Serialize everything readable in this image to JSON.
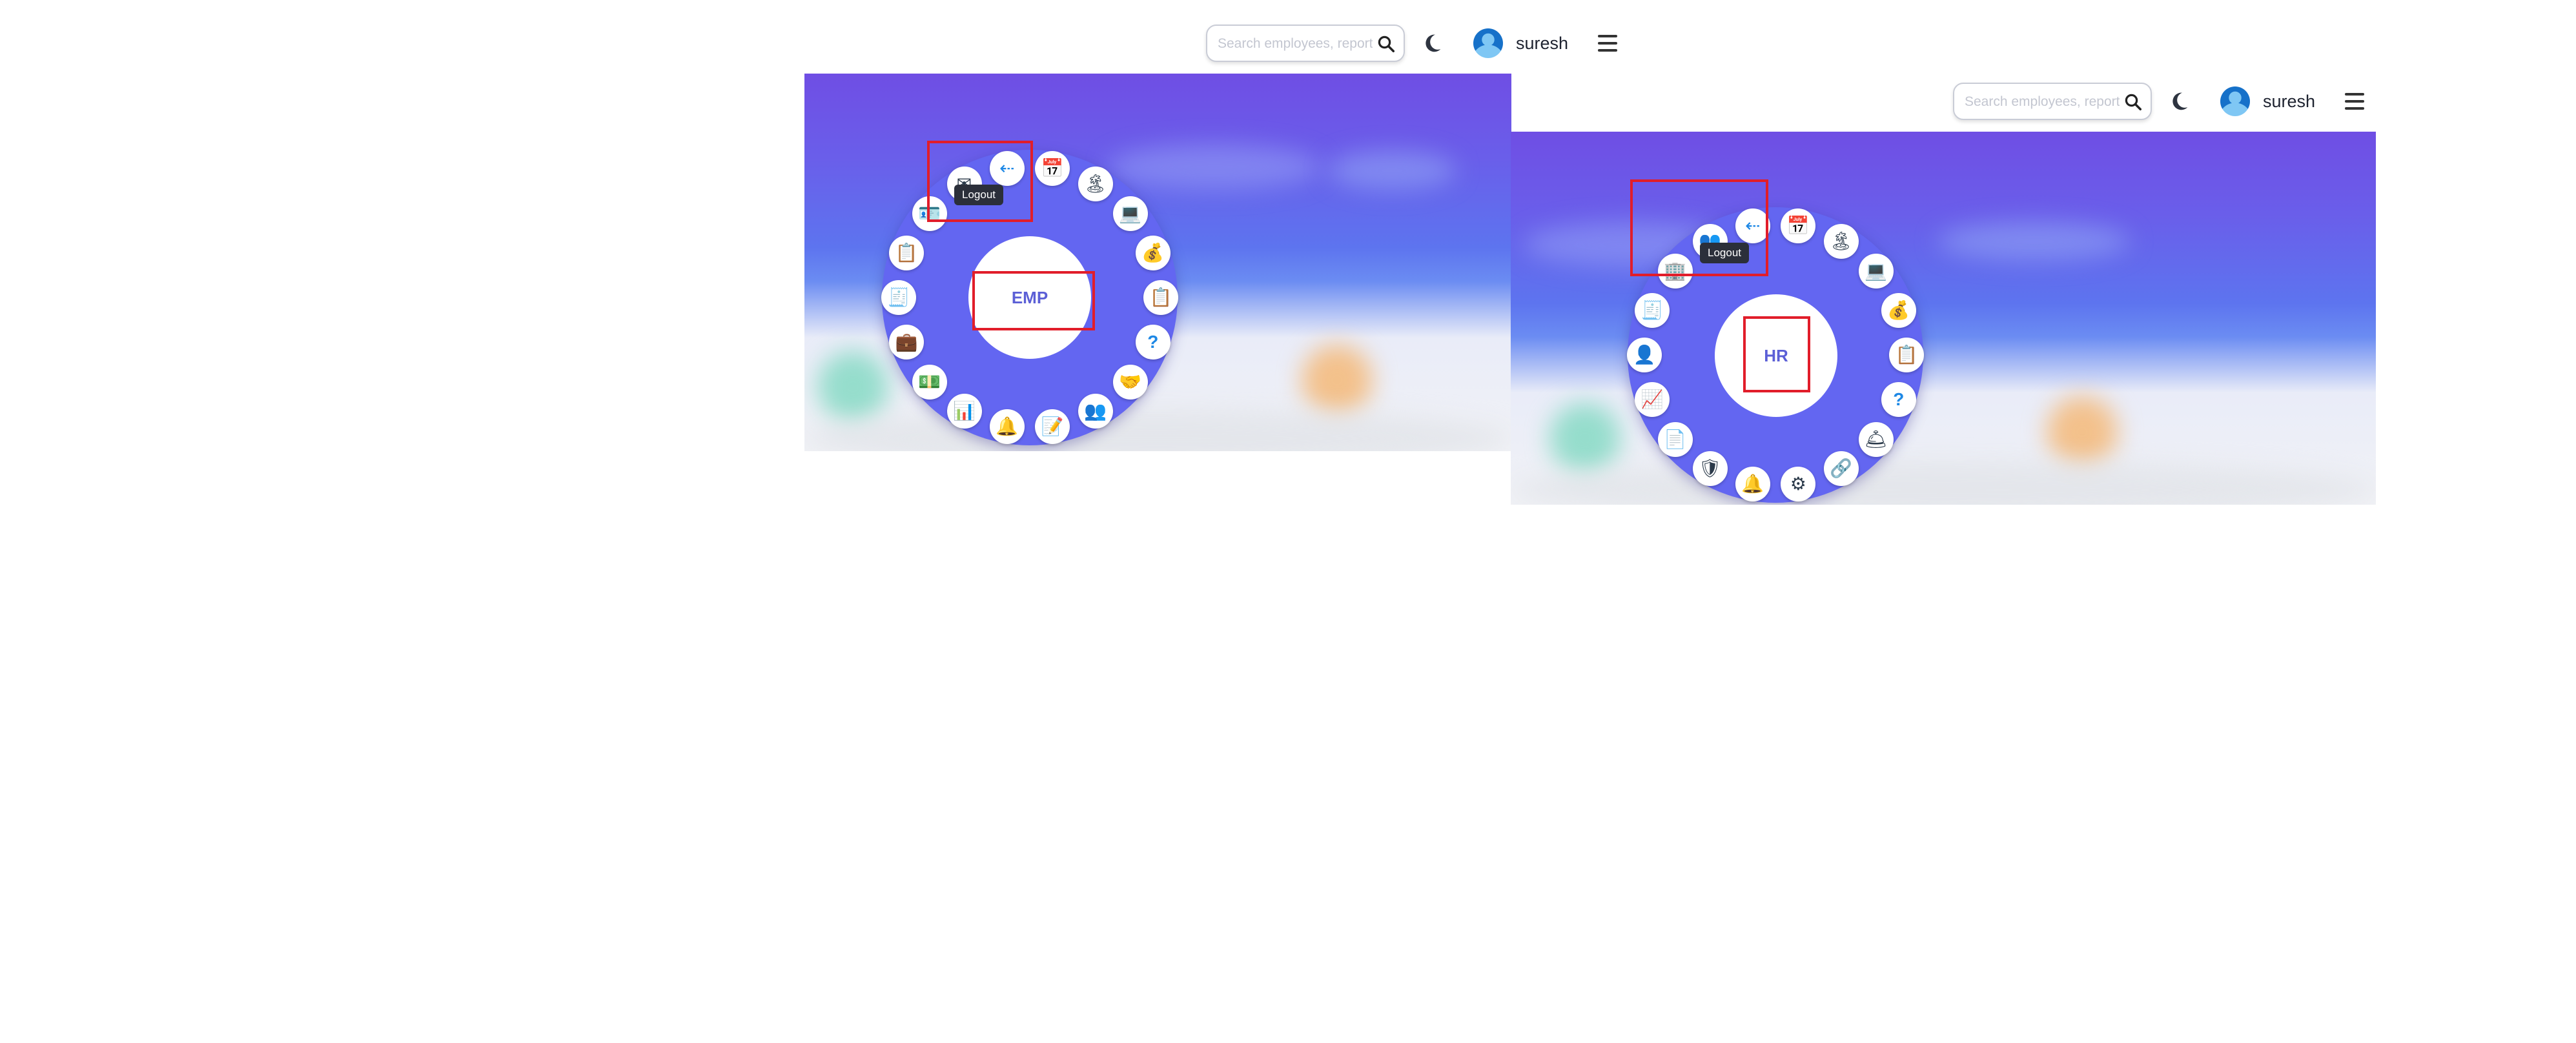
{
  "header": {
    "search_placeholder": "Search employees, reports...",
    "username": "suresh"
  },
  "icons": {
    "search": "search-icon",
    "theme": "moon-icon",
    "avatar": "user-avatar-icon",
    "menu": "hamburger-menu-icon"
  },
  "emp_panel": {
    "center_label": "EMP",
    "tooltip": "Logout",
    "items": [
      {
        "name": "logout",
        "glyph": "⇠"
      },
      {
        "name": "calendar",
        "glyph": "📅"
      },
      {
        "name": "holiday",
        "glyph": "🏝"
      },
      {
        "name": "laptop",
        "glyph": "💻"
      },
      {
        "name": "money-bag",
        "glyph": "💰"
      },
      {
        "name": "document",
        "glyph": "📋"
      },
      {
        "name": "help",
        "glyph": "?"
      },
      {
        "name": "handshake",
        "glyph": "🤝"
      },
      {
        "name": "team",
        "glyph": "👥"
      },
      {
        "name": "checklist",
        "glyph": "📝"
      },
      {
        "name": "bell",
        "glyph": "🔔"
      },
      {
        "name": "report",
        "glyph": "📊"
      },
      {
        "name": "payroll",
        "glyph": "💵"
      },
      {
        "name": "briefcase",
        "glyph": "💼"
      },
      {
        "name": "form",
        "glyph": "🧾"
      },
      {
        "name": "clipboard",
        "glyph": "📋"
      },
      {
        "name": "id-card",
        "glyph": "🪪"
      },
      {
        "name": "mail",
        "glyph": "✉"
      }
    ]
  },
  "hr_panel": {
    "center_label": "HR",
    "tooltip": "Logout",
    "items": [
      {
        "name": "logout",
        "glyph": "⇠"
      },
      {
        "name": "calendar",
        "glyph": "📅"
      },
      {
        "name": "holiday",
        "glyph": "🏝"
      },
      {
        "name": "laptop",
        "glyph": "💻"
      },
      {
        "name": "money-bag",
        "glyph": "💰"
      },
      {
        "name": "document",
        "glyph": "📋"
      },
      {
        "name": "help",
        "glyph": "?"
      },
      {
        "name": "desk",
        "glyph": "🛎"
      },
      {
        "name": "network",
        "glyph": "🔗"
      },
      {
        "name": "settings",
        "glyph": "⚙"
      },
      {
        "name": "bell",
        "glyph": "🔔"
      },
      {
        "name": "security",
        "glyph": "🛡"
      },
      {
        "name": "file",
        "glyph": "📄"
      },
      {
        "name": "analytics",
        "glyph": "📈"
      },
      {
        "name": "add-user",
        "glyph": "👤"
      },
      {
        "name": "onboarding",
        "glyph": "🧾"
      },
      {
        "name": "building",
        "glyph": "🏢"
      },
      {
        "name": "group",
        "glyph": "👥"
      }
    ]
  },
  "colors": {
    "ring": "#6366f1",
    "highlight": "#e11d2a",
    "header_text": "#1e2330"
  }
}
